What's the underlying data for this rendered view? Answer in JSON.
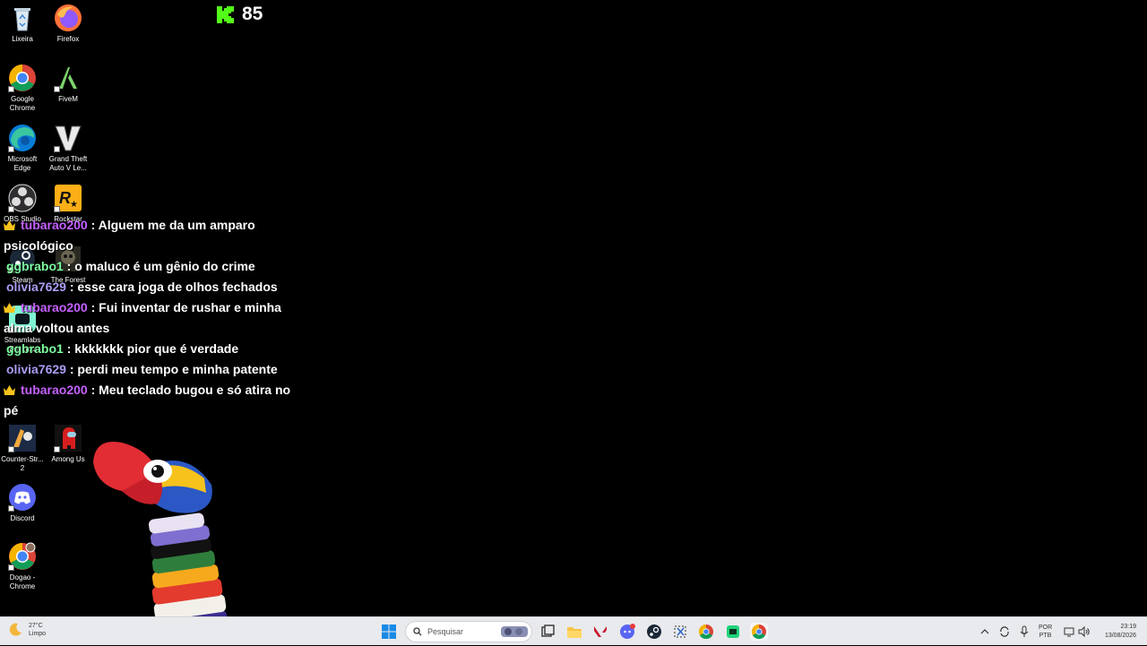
{
  "desktop_icons": [
    {
      "label": "Lixeira",
      "icon": "recycle-bin-icon"
    },
    {
      "label": "Firefox",
      "icon": "firefox-icon"
    },
    {
      "label": "Google Chrome",
      "icon": "chrome-icon"
    },
    {
      "label": "FiveM",
      "icon": "fivem-icon"
    },
    {
      "label": "Microsoft Edge",
      "icon": "edge-icon"
    },
    {
      "label": "Grand Theft Auto V Le...",
      "icon": "gta-v-icon"
    },
    {
      "label": "OBS Studio",
      "icon": "obs-icon"
    },
    {
      "label": "Rockstar",
      "icon": "rockstar-icon"
    },
    {
      "label": "Steam",
      "icon": "steam-icon"
    },
    {
      "label": "The Forest",
      "icon": "the-forest-icon"
    },
    {
      "label": "Streamlabs Desktop",
      "icon": "streamlabs-icon"
    },
    {
      "label": "Counter-Str... 2",
      "icon": "counter-strike-icon"
    },
    {
      "label": "Among Us",
      "icon": "among-us-icon"
    },
    {
      "label": "Discord",
      "icon": "discord-icon"
    },
    {
      "label": "Dogao - Chrome",
      "icon": "chrome-profile-icon"
    }
  ],
  "kick": {
    "count": "85",
    "icon": "kick-logo-icon",
    "color": "#53fc18"
  },
  "chat": {
    "messages": [
      {
        "user": "tubarao200",
        "badge": "crown",
        "color": "#c561ff",
        "text": ": Alguem me da um amparo psicológico"
      },
      {
        "user": "ggbrabo1",
        "badge": "",
        "color": "#7dffa0",
        "text": ": o maluco é um gênio do crime"
      },
      {
        "user": "olivia7629",
        "badge": "",
        "color": "#a99ef5",
        "text": ": esse cara joga de olhos fechados"
      },
      {
        "user": "tubarao200",
        "badge": "crown",
        "color": "#c561ff",
        "text": ": Fui inventar de rushar e minha alma voltou antes"
      },
      {
        "user": "ggbrabo1",
        "badge": "",
        "color": "#7dffa0",
        "text": ": kkkkkkk pior que é verdade"
      },
      {
        "user": "olivia7629",
        "badge": "",
        "color": "#a99ef5",
        "text": ": perdi meu tempo e minha patente"
      },
      {
        "user": "tubarao200",
        "badge": "crown",
        "color": "#c561ff",
        "text": ": Meu teclado bugou e só atira no pé"
      }
    ]
  },
  "taskbar": {
    "weather": {
      "temp": "27°C",
      "condition": "Limpo"
    },
    "search_placeholder": "Pesquisar",
    "language": "POR",
    "layout": "PTB",
    "time": "23:19",
    "date": "13/08/2026"
  }
}
